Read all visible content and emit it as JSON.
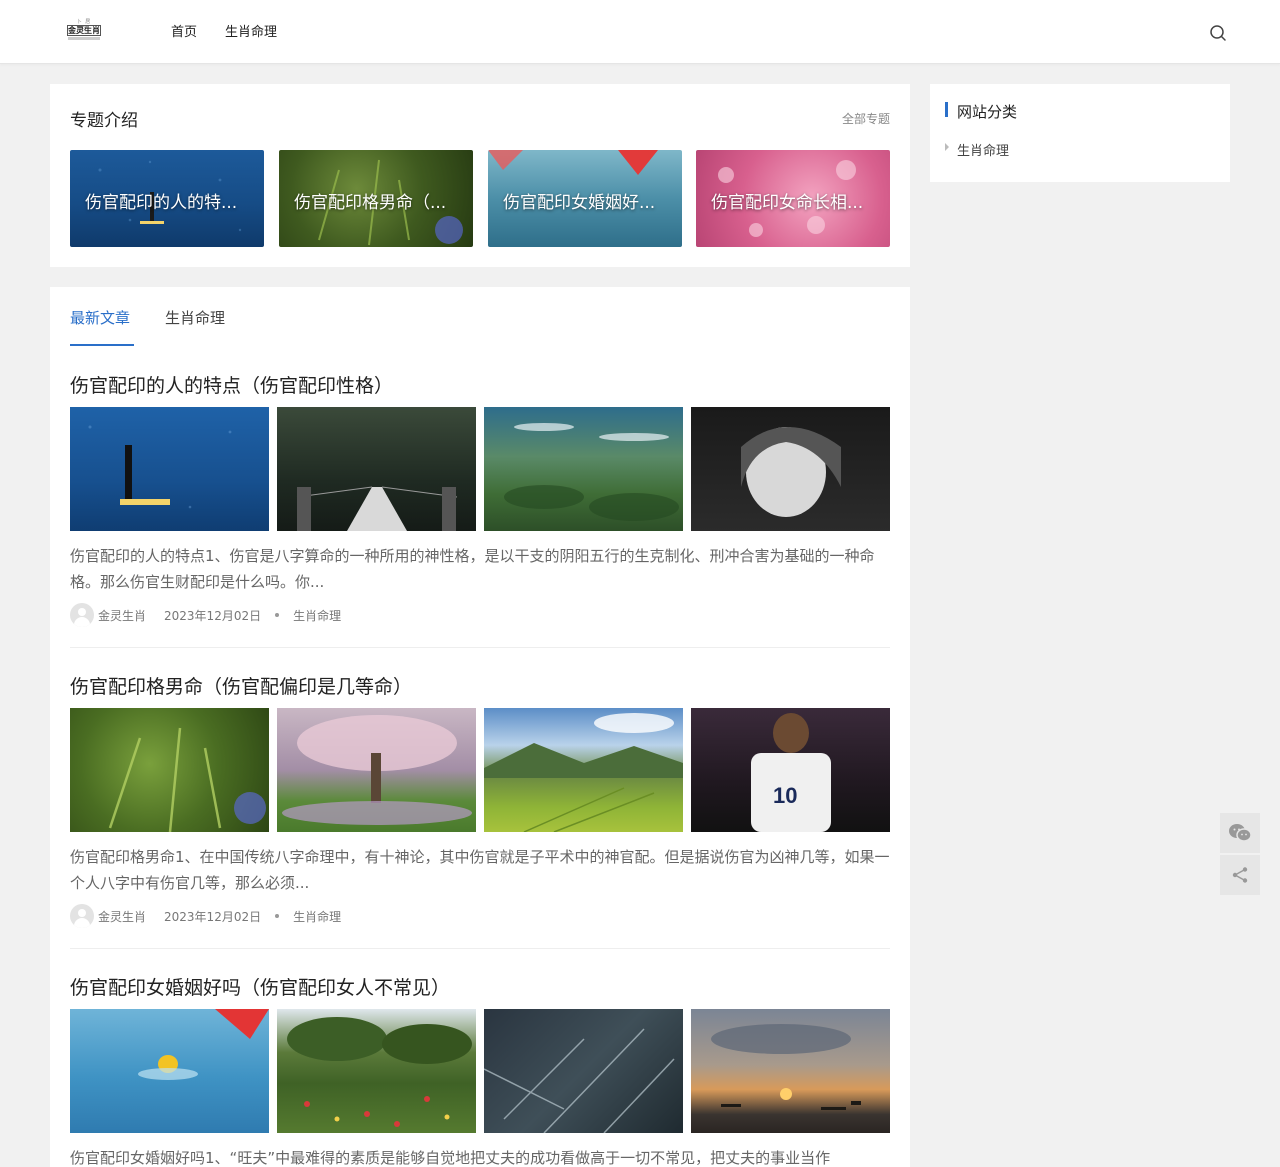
{
  "header": {
    "logo_top": "卜 居 之",
    "logo_main": "金灵生肖",
    "nav": [
      "首页",
      "生肖命理"
    ]
  },
  "topics": {
    "title": "专题介绍",
    "more": "全部专题",
    "cards": [
      {
        "label": "伤官配印的人的特..."
      },
      {
        "label": "伤官配印格男命（..."
      },
      {
        "label": "伤官配印女婚姻好..."
      },
      {
        "label": "伤官配印女命长相..."
      }
    ]
  },
  "tabs": [
    "最新文章",
    "生肖命理"
  ],
  "articles": [
    {
      "title": "伤官配印的人的特点（伤官配印性格）",
      "excerpt": "伤官配印的人的特点1、伤官是八字算命的一种所用的神性格，是以干支的阴阳五行的生克制化、刑冲合害为基础的一种命格。那么伤官生财配印是什么吗。你...",
      "author": "金灵生肖",
      "date": "2023年12月02日",
      "category": "生肖命理"
    },
    {
      "title": "伤官配印格男命（伤官配偏印是几等命）",
      "excerpt": "伤官配印格男命1、在中国传统八字命理中，有十神论，其中伤官就是子平术中的神官配。但是据说伤官为凶神几等，如果一个人八字中有伤官几等，那么必须...",
      "author": "金灵生肖",
      "date": "2023年12月02日",
      "category": "生肖命理"
    },
    {
      "title": "伤官配印女婚姻好吗（伤官配印女人不常见）",
      "excerpt": "伤官配印女婚姻好吗1、“旺夫”中最难得的素质是能够自觉地把丈夫的成功看做高于一切不常见，把丈夫的事业当作"
    }
  ],
  "sidebar": {
    "title": "网站分类",
    "items": [
      "生肖命理"
    ]
  },
  "icons": {
    "search": "search-icon",
    "wechat": "wechat-icon",
    "share": "share-icon"
  },
  "colors": {
    "accent": "#2a6fc9"
  }
}
